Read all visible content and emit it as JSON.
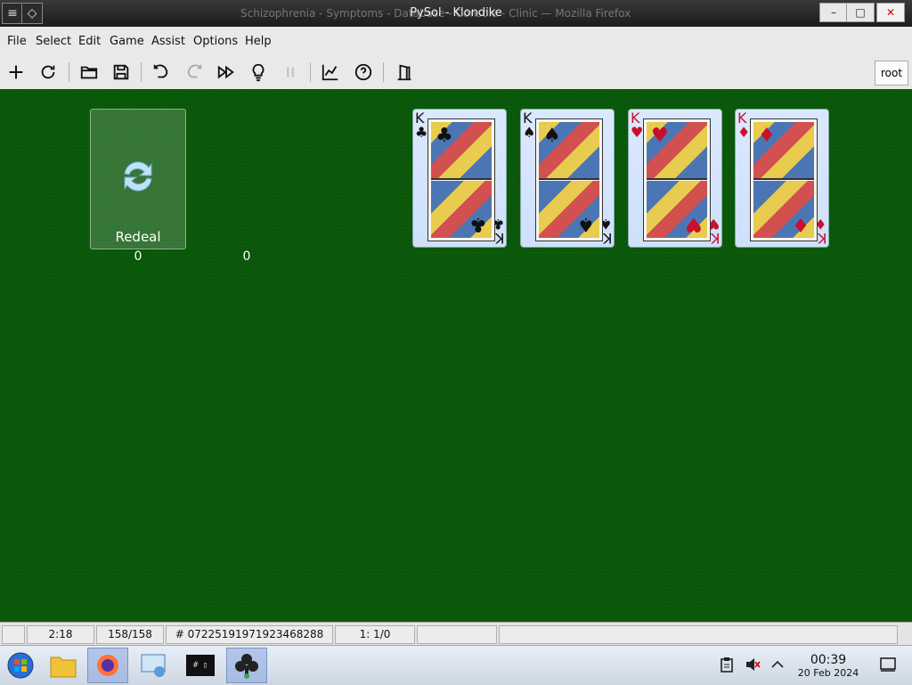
{
  "window": {
    "title": "PySol - Klondike",
    "background_title": "Schizophrenia - Symptoms - Database - Console - Clinic — Mozilla Firefox",
    "minimize": "–",
    "maximize": "□",
    "close": "✕"
  },
  "menu": [
    "File",
    "Select",
    "Edit",
    "Game",
    "Assist",
    "Options",
    "Help"
  ],
  "toolbar": {
    "user": "root"
  },
  "game": {
    "redeal_label": "Redeal",
    "talon_count": "0",
    "waste_count": "0",
    "foundations": [
      {
        "rank": "K",
        "suit": "♣",
        "color": "#111111"
      },
      {
        "rank": "K",
        "suit": "♠",
        "color": "#111111"
      },
      {
        "rank": "K",
        "suit": "♥",
        "color": "#c8102e"
      },
      {
        "rank": "K",
        "suit": "♦",
        "color": "#c8102e"
      }
    ]
  },
  "status": {
    "time": "2:18",
    "moves": "158/158",
    "game_number": "# 07225191971923468288",
    "score": "1: 1/0",
    "blank1": "",
    "blank2": ""
  },
  "taskbar": {
    "time": "00:39",
    "date": "20 Feb 2024",
    "terminal_text": "# ▯"
  }
}
